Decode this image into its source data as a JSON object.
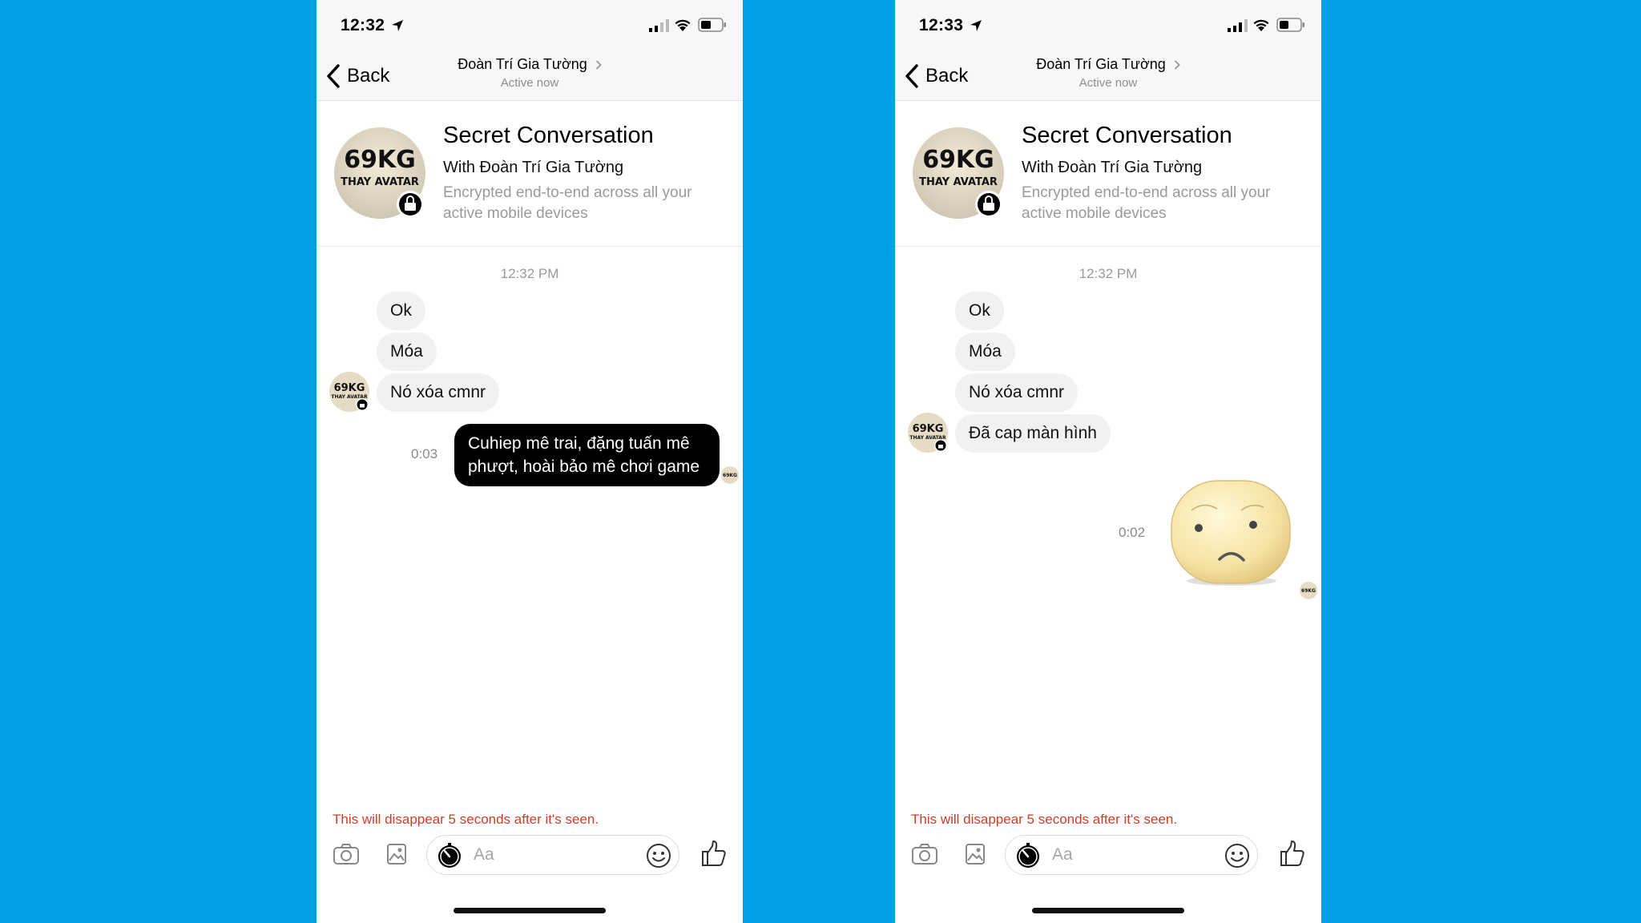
{
  "colors": {
    "background": "#00a1e4",
    "warning_text": "#d33b28",
    "sent_bubble": "#000000",
    "received_bubble": "#f1f1f1"
  },
  "avatar_text": {
    "line1": "69KG",
    "line2": "THAY AVATAR"
  },
  "screens": [
    {
      "status": {
        "time": "12:32",
        "icons": [
          "location-arrow-icon",
          "signal-icon",
          "wifi-icon",
          "battery-icon"
        ]
      },
      "nav": {
        "back_label": "Back",
        "title": "Đoàn Trí Gia Tường",
        "subtitle": "Active now"
      },
      "header": {
        "title": "Secret Conversation",
        "with": "With Đoàn Trí Gia Tường",
        "description": "Encrypted end-to-end across all your active mobile devices"
      },
      "timestamp": "12:32 PM",
      "received": [
        "Ok",
        "Móa",
        "Nó xóa cmnr"
      ],
      "sent": {
        "text": "Cuhiep mê trai, đặng tuấn mê phượt, hoài bảo mê chơi game",
        "timer": "0:03"
      },
      "disappear_note": "This will disappear 5 seconds after it's seen.",
      "composer": {
        "placeholder": "Aa"
      }
    },
    {
      "status": {
        "time": "12:33",
        "icons": [
          "location-arrow-icon",
          "signal-icon",
          "wifi-icon",
          "battery-icon"
        ]
      },
      "nav": {
        "back_label": "Back",
        "title": "Đoàn Trí Gia Tường",
        "subtitle": "Active now"
      },
      "header": {
        "title": "Secret Conversation",
        "with": "With Đoàn Trí Gia Tường",
        "description": "Encrypted end-to-end across all your active mobile devices"
      },
      "timestamp": "12:32 PM",
      "received": [
        "Ok",
        "Móa",
        "Nó xóa cmnr",
        "Đã cap màn hình"
      ],
      "sent": {
        "sticker": "sad-face-sticker",
        "timer": "0:02"
      },
      "disappear_note": "This will disappear 5 seconds after it's seen.",
      "composer": {
        "placeholder": "Aa"
      }
    }
  ]
}
